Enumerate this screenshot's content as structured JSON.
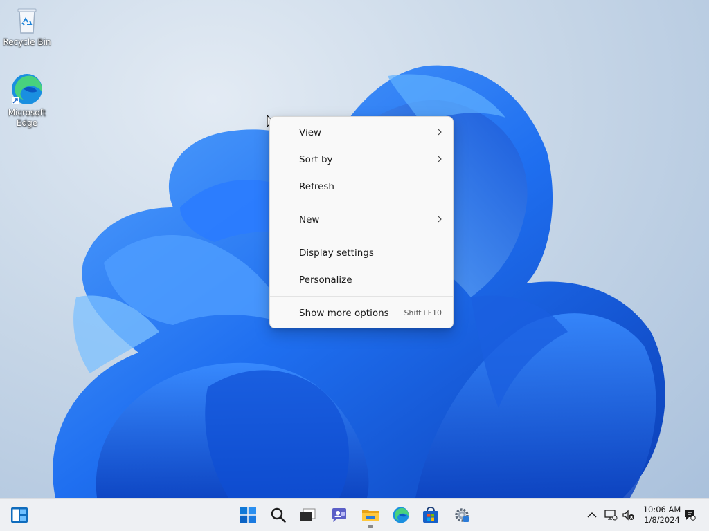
{
  "desktop": {
    "icons": [
      {
        "label": "Recycle Bin",
        "icon": "recycle-bin-icon"
      },
      {
        "label": "Microsoft Edge",
        "icon": "edge-icon"
      }
    ],
    "accent_color": "#1a5fe0"
  },
  "context_menu": {
    "items": [
      {
        "label": "View",
        "submenu": true
      },
      {
        "label": "Sort by",
        "submenu": true
      },
      {
        "label": "Refresh"
      },
      {
        "label": "New",
        "submenu": true
      },
      {
        "label": "Display settings"
      },
      {
        "label": "Personalize"
      },
      {
        "label": "Show more options",
        "shortcut": "Shift+F10"
      }
    ]
  },
  "taskbar": {
    "apps": [
      {
        "name": "widgets",
        "icon": "widgets-icon"
      },
      {
        "name": "start",
        "icon": "windows-logo-icon"
      },
      {
        "name": "search",
        "icon": "search-icon"
      },
      {
        "name": "task-view",
        "icon": "task-view-icon"
      },
      {
        "name": "chat",
        "icon": "chat-icon"
      },
      {
        "name": "file-explorer",
        "icon": "folder-icon"
      },
      {
        "name": "edge",
        "icon": "edge-icon"
      },
      {
        "name": "store",
        "icon": "store-icon"
      },
      {
        "name": "settings",
        "icon": "settings-icon"
      }
    ],
    "clock": {
      "time": "10:06 AM",
      "date": "1/8/2024"
    }
  }
}
